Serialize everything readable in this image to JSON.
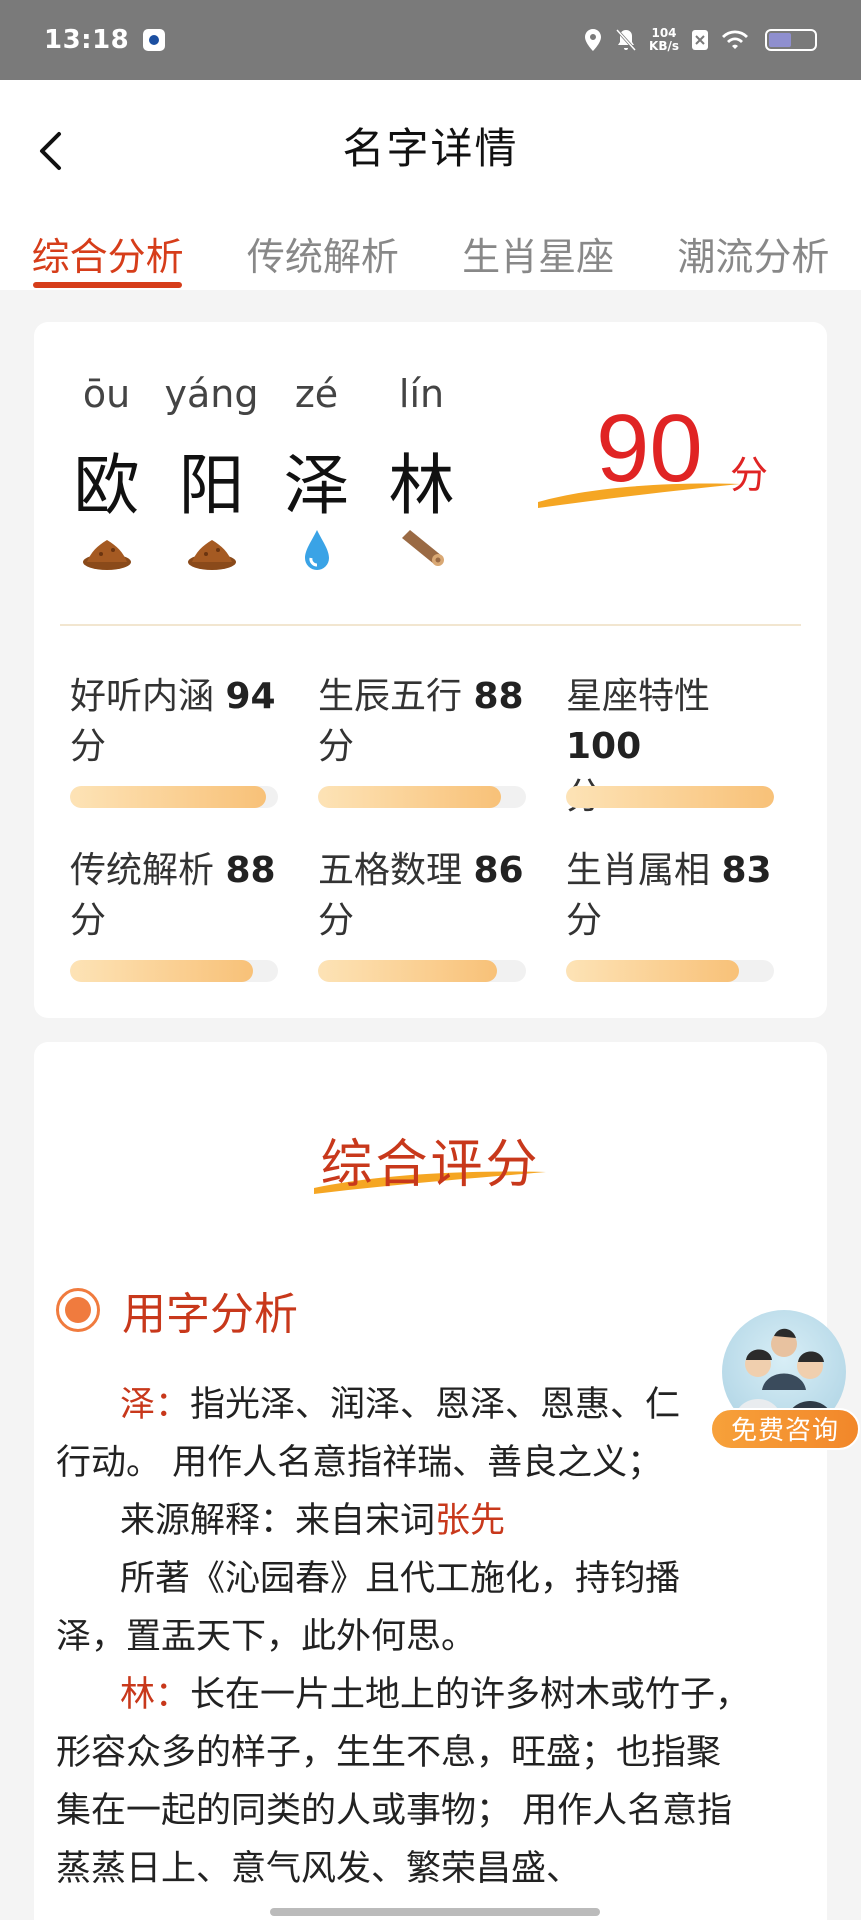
{
  "status": {
    "time": "13:18",
    "net_speed_value": "104",
    "net_speed_unit": "KB/s",
    "icons": [
      "location-icon",
      "mute-icon",
      "sim-off-icon",
      "wifi-icon",
      "battery-icon"
    ]
  },
  "header": {
    "title": "名字详情",
    "back_icon": "chevron-left-icon"
  },
  "tabs": [
    {
      "label": "综合分析",
      "active": true
    },
    {
      "label": "传统解析",
      "active": false
    },
    {
      "label": "生肖星座",
      "active": false
    },
    {
      "label": "潮流分析",
      "active": false
    }
  ],
  "name": {
    "chars": [
      {
        "pinyin": "ōu",
        "hanzi": "欧",
        "element_icon": "earth-icon"
      },
      {
        "pinyin": "yáng",
        "hanzi": "阳",
        "element_icon": "earth-icon"
      },
      {
        "pinyin": "zé",
        "hanzi": "泽",
        "element_icon": "water-drop-icon"
      },
      {
        "pinyin": "lín",
        "hanzi": "林",
        "element_icon": "wood-log-icon"
      }
    ],
    "score": "90",
    "score_unit": "分"
  },
  "metrics": [
    {
      "label": "好听内涵",
      "value": "94",
      "unit": "分",
      "percent": 94
    },
    {
      "label": "生辰五行",
      "value": "88",
      "unit": "分",
      "percent": 88
    },
    {
      "label": "星座特性",
      "value": "100",
      "unit": "分",
      "percent": 100
    },
    {
      "label": "传统解析",
      "value": "88",
      "unit": "分",
      "percent": 88
    },
    {
      "label": "五格数理",
      "value": "86",
      "unit": "分",
      "percent": 86
    },
    {
      "label": "生肖属相",
      "value": "83",
      "unit": "分",
      "percent": 83
    }
  ],
  "analysis": {
    "section_title": "综合评分",
    "sub_title": "用字分析",
    "ze_char": "泽：",
    "ze_text": "指光泽、润泽、恩泽、恩惠、仁",
    "ze_text2": "行动。 用作人名意指祥瑞、善良之义；",
    "source_label": "来源解释：来自宋词",
    "source_author": "张先",
    "source_text": "所著《沁园春》且代工施化，持钧播",
    "source_text2": "泽，置盂天下，此外何思。",
    "lin_char": "林：",
    "lin_text": "长在一片土地上的许多树木或竹子，",
    "lin_text2": "形容众多的样子，生生不息，旺盛；也指聚",
    "lin_text3": "集在一起的同类的人或事物； 用作人名意指",
    "lin_text4": "蒸蒸日上、意气风发、繁荣昌盛、"
  },
  "consult": {
    "label": "免费咨询"
  }
}
